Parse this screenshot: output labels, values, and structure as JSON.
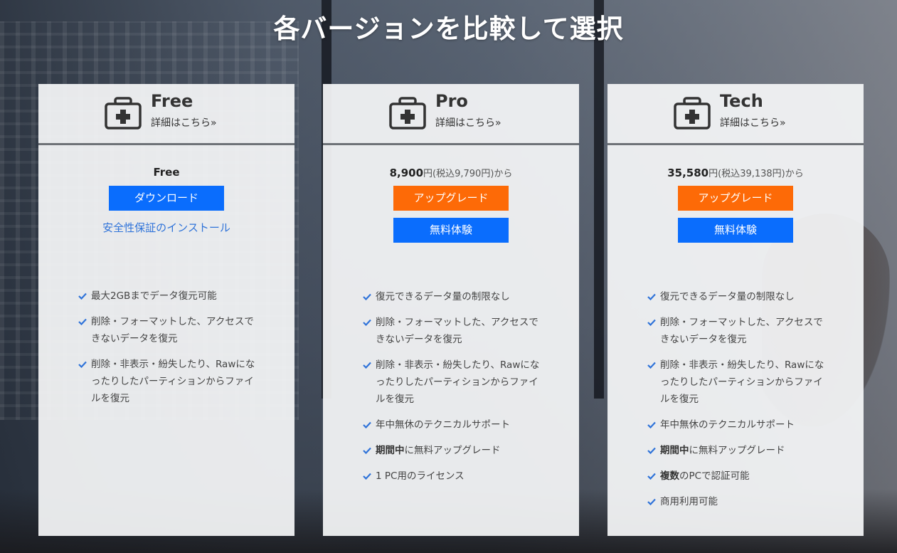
{
  "page": {
    "title": "各バージョンを比較して選択"
  },
  "colors": {
    "primary_blue": "#0a6dfd",
    "upgrade_orange": "#fd6a07",
    "link_blue": "#2f73d9",
    "check_blue": "#2f73d9"
  },
  "plans": [
    {
      "name": "Free",
      "detail_link": "詳細はこちら»",
      "price_label": "Free",
      "primary_button": "ダウンロード",
      "safe_install_link": "安全性保証のインストール",
      "icon": "first-aid-kit-icon",
      "features": [
        {
          "text": "最大2GBまでデータ復元可能"
        },
        {
          "text": "削除・フォーマットした、アクセスできないデータを復元"
        },
        {
          "text": "削除・非表示・紛失したり、Rawになったりしたパーティションからファイルを復元"
        }
      ]
    },
    {
      "name": "Pro",
      "detail_link": "詳細はこちら»",
      "price_main": "8,900",
      "price_unit": "円(税込9,790円)から",
      "upgrade_button": "アップグレード",
      "trial_button": "無料体験",
      "icon": "first-aid-kit-icon",
      "features": [
        {
          "text": "復元できるデータ量の制限なし"
        },
        {
          "text": "削除・フォーマットした、アクセスできないデータを復元"
        },
        {
          "text": "削除・非表示・紛失したり、Rawになったりしたパーティションからファイルを復元"
        },
        {
          "text": "年中無休のテクニカルサポート"
        },
        {
          "bold": "期間中",
          "text": "に無料アップグレード"
        },
        {
          "text": "1 PC用のライセンス"
        }
      ]
    },
    {
      "name": "Tech",
      "detail_link": "詳細はこちら»",
      "price_main": "35,580",
      "price_unit": "円(税込39,138円)から",
      "upgrade_button": "アップグレード",
      "trial_button": "無料体験",
      "icon": "first-aid-kit-icon",
      "features": [
        {
          "text": "復元できるデータ量の制限なし"
        },
        {
          "text": "削除・フォーマットした、アクセスできないデータを復元"
        },
        {
          "text": "削除・非表示・紛失したり、Rawになったりしたパーティションからファイルを復元"
        },
        {
          "text": "年中無休のテクニカルサポート"
        },
        {
          "bold": "期間中",
          "text": "に無料アップグレード"
        },
        {
          "bold": "複数",
          "text": "のPCで認証可能"
        },
        {
          "text": "商用利用可能"
        }
      ]
    }
  ]
}
